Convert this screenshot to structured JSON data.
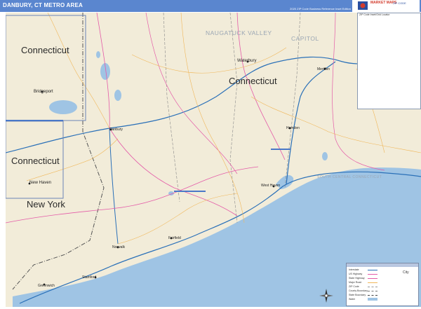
{
  "header": {
    "title": "DANBURY, CT METRO AREA",
    "edition": "2020 ZIP Code Business Reference Inset Edition"
  },
  "colors": {
    "header_bar": "#5a86cf",
    "land": "#f2ecd9",
    "water": "#9fc4e4",
    "interstate": "#2a70b8",
    "highway": "#e45ca8",
    "road": "#f0b75a",
    "boundary": "#555555"
  },
  "inset": {
    "caption": "ZIP Code Inset/Grid Locator"
  },
  "labels": {
    "states": [
      "Connecticut",
      "Connecticut",
      "Connecticut",
      "New York"
    ],
    "regions": [
      "NAUGATUCK VALLEY",
      "CAPITOL",
      "SOUTH CENTRAL CONNECTICUT"
    ],
    "cities": [
      "Waterbury",
      "Bridgeport",
      "Danbury",
      "New Haven",
      "Meriden",
      "Hamden",
      "Stamford",
      "Norwalk",
      "Fairfield",
      "West Haven",
      "Greenwich"
    ]
  },
  "legend": {
    "rows": [
      "Interstate",
      "US Highway",
      "State Highway",
      "Major Road",
      "ZIP Code",
      "County Boundary",
      "State Boundary",
      "Water"
    ],
    "city_symbol": "City"
  },
  "icons": {
    "compass": "compass-rose-icon",
    "logo": "publisher-logo-icon"
  }
}
